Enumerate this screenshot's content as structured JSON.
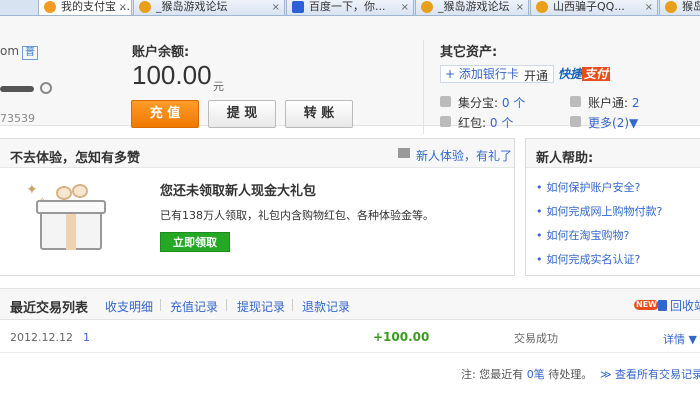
{
  "browser": {
    "tabs": [
      {
        "label": "我的支付宝 ...",
        "active": true,
        "icon": "alipay-icon"
      },
      {
        "label": "_猴岛游戏论坛",
        "active": false,
        "icon": "monkey-icon"
      },
      {
        "label": "百度一下，你...",
        "active": false,
        "icon": "baidu-paw-icon"
      },
      {
        "label": "_猴岛游戏论坛",
        "active": false,
        "icon": "monkey-icon"
      },
      {
        "label": "山西骗子QQ...",
        "active": false,
        "icon": "monkey-icon"
      },
      {
        "label": "猴岛",
        "active": false,
        "icon": "monkey-icon"
      }
    ]
  },
  "account": {
    "user_fragment": "om",
    "verified_badge": "普",
    "user_id_fragment": "73539",
    "balance_label": "账户余额:",
    "balance_amount": "100.00",
    "balance_unit": "元",
    "buttons": {
      "charge": "充 值",
      "withdraw": "提 现",
      "transfer": "转 账"
    }
  },
  "other_assets": {
    "title": "其它资产:",
    "add_bank": "+ 添加银行卡",
    "activate": "开通",
    "express_pay": {
      "part1": "快捷",
      "part2": "支付"
    },
    "items": [
      {
        "label": "集分宝:",
        "value": "0 个"
      },
      {
        "label": "红包:",
        "value": "0 个"
      },
      {
        "label": "账户通:",
        "value": "2"
      },
      {
        "label": "更多(",
        "value": "2",
        "suffix": ")▼"
      }
    ]
  },
  "promo": {
    "title": "不去体验，怎知有多赞",
    "link": "新人体验，有礼了",
    "heading": "您还未领取新人现金大礼包",
    "desc": "已有138万人领取，礼包内含购物红包、各种体验金等。",
    "button": "立即领取"
  },
  "help": {
    "title": "新人帮助:",
    "items": [
      "如何保护账户安全?",
      "如何完成网上购物付款?",
      "如何在淘宝购物?",
      "如何完成实名认证?"
    ]
  },
  "transactions": {
    "title": "最近交易列表",
    "tabs": [
      "收支明细",
      "充值记录",
      "提现记录",
      "退款记录"
    ],
    "new_badge": "NEW",
    "recycle": "回收站",
    "rows": [
      {
        "date": "2012.12.12",
        "num": "1",
        "amount": "+100.00",
        "status": "交易成功",
        "detail": "详情 ▼"
      }
    ],
    "footnote": {
      "prefix": "注: 您最近有",
      "count": "0笔",
      "suffix": "待处理。"
    },
    "view_all": "≫ 查看所有交易记录"
  },
  "colors": {
    "accent_orange": "#f07800",
    "link_blue": "#3366cc",
    "success_green": "#26a827",
    "amount_green": "#3a9c1e"
  }
}
